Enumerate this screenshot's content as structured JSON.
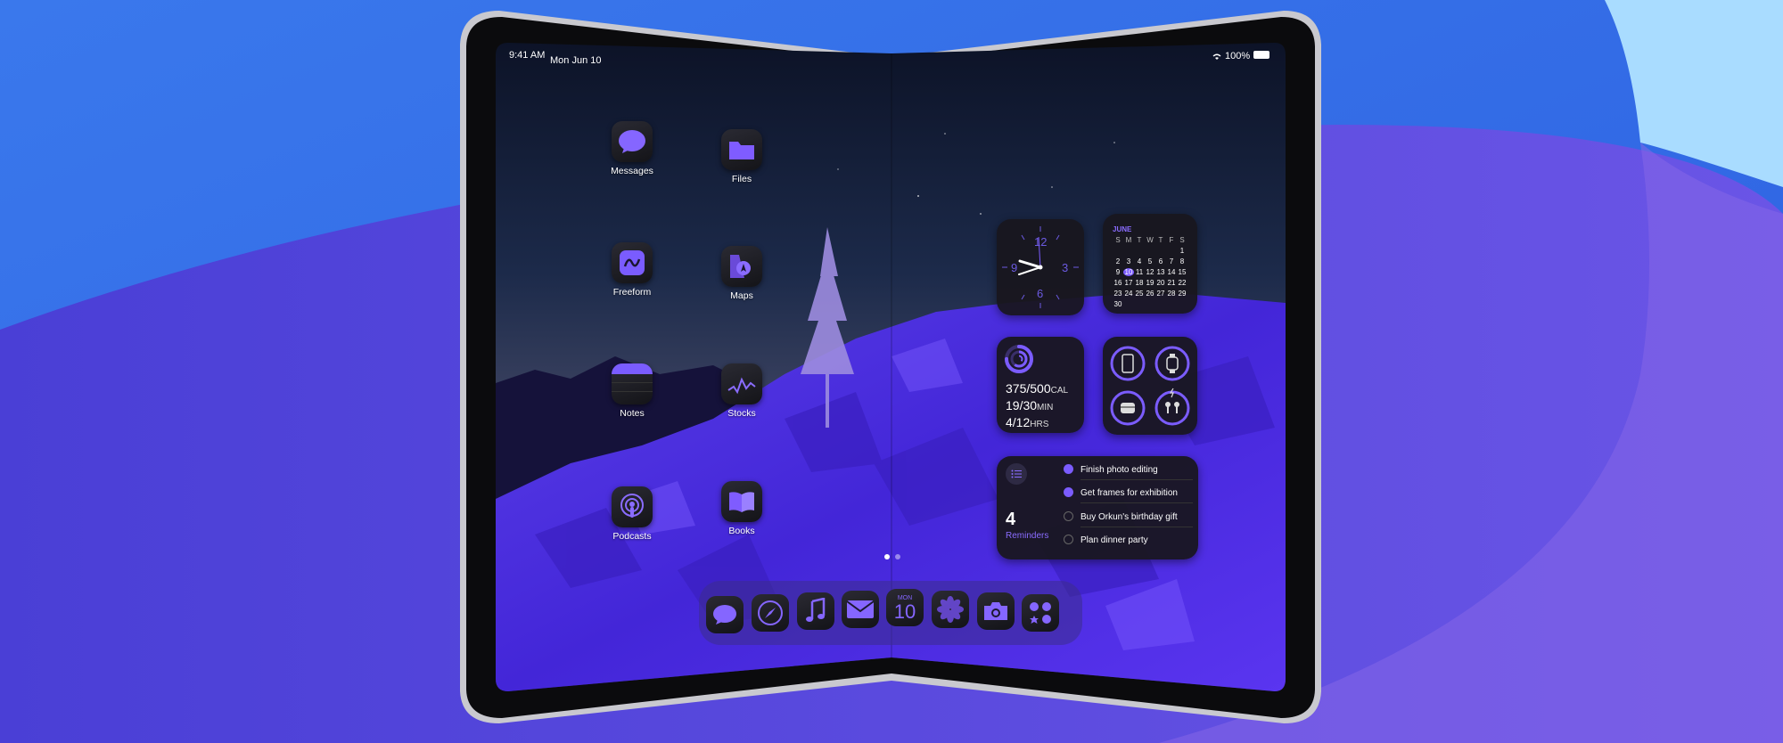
{
  "status_bar": {
    "time": "9:41 AM",
    "date": "Mon Jun 10",
    "battery": "100%"
  },
  "apps": {
    "messages": "Messages",
    "files": "Files",
    "freeform": "Freeform",
    "maps": "Maps",
    "notes": "Notes",
    "stocks": "Stocks",
    "podcasts": "Podcasts",
    "books": "Books"
  },
  "clock_widget": {
    "n12": "12",
    "n3": "3",
    "n6": "6",
    "n9": "9"
  },
  "calendar_widget": {
    "month": "JUNE",
    "weekdays": [
      "S",
      "M",
      "T",
      "W",
      "T",
      "F",
      "S"
    ],
    "rows": [
      [
        "",
        "",
        "",
        "",
        "",
        "",
        "1"
      ],
      [
        "2",
        "3",
        "4",
        "5",
        "6",
        "7",
        "8"
      ],
      [
        "9",
        "10",
        "11",
        "12",
        "13",
        "14",
        "15"
      ],
      [
        "16",
        "17",
        "18",
        "19",
        "20",
        "21",
        "22"
      ],
      [
        "23",
        "24",
        "25",
        "26",
        "27",
        "28",
        "29"
      ],
      [
        "30",
        "",
        "",
        "",
        "",
        "",
        ""
      ]
    ],
    "today": "10"
  },
  "fitness_widget": {
    "move_value": "375/500",
    "move_unit": "CAL",
    "exercise_value": "19/30",
    "exercise_unit": "MIN",
    "stand_value": "4/12",
    "stand_unit": "HRS",
    "move_progress": 0.75
  },
  "reminders_widget": {
    "count": "4",
    "title": "Reminders",
    "items": [
      {
        "text": "Finish photo editing",
        "done": true
      },
      {
        "text": "Get frames for exhibition",
        "done": true
      },
      {
        "text": "Buy Orkun's birthday gift",
        "done": false
      },
      {
        "text": "Plan dinner party",
        "done": false
      }
    ]
  },
  "dock": {
    "calendar_day": "MON",
    "calendar_date": "10",
    "icons": [
      "messages-icon",
      "safari-icon",
      "music-icon",
      "mail-icon",
      "calendar-icon",
      "photos-icon",
      "camera-icon",
      "app-folder-icon"
    ]
  },
  "colors": {
    "accent": "#7b5cff",
    "widget_bg": "#18161e",
    "background": "#3b5fe0"
  }
}
